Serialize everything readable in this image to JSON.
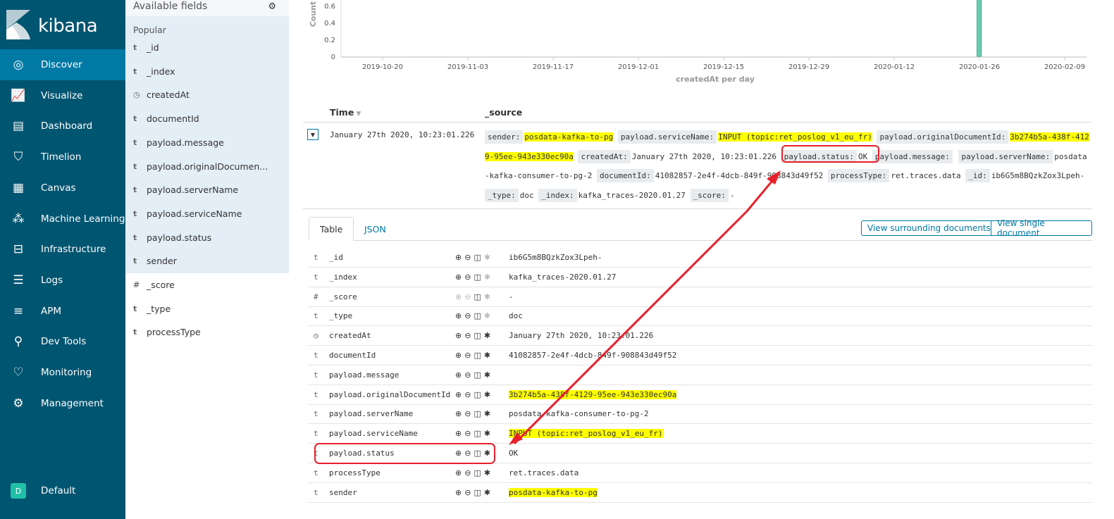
{
  "app": {
    "logo_text": "kibana"
  },
  "nav": {
    "items": [
      {
        "label": "Discover",
        "icon": "compass-icon",
        "active": true
      },
      {
        "label": "Visualize",
        "icon": "visualize-icon"
      },
      {
        "label": "Dashboard",
        "icon": "dashboard-icon"
      },
      {
        "label": "Timelion",
        "icon": "timelion-icon"
      },
      {
        "label": "Canvas",
        "icon": "canvas-icon"
      },
      {
        "label": "Machine Learning",
        "icon": "ml-icon"
      },
      {
        "label": "Infrastructure",
        "icon": "infrastructure-icon"
      },
      {
        "label": "Logs",
        "icon": "logs-icon"
      },
      {
        "label": "APM",
        "icon": "apm-icon"
      },
      {
        "label": "Dev Tools",
        "icon": "wrench-icon"
      },
      {
        "label": "Monitoring",
        "icon": "heartbeat-icon"
      },
      {
        "label": "Management",
        "icon": "gear-icon"
      }
    ],
    "space": {
      "badge": "D",
      "label": "Default"
    }
  },
  "fields": {
    "title": "Available fields",
    "popular_label": "Popular",
    "items": [
      {
        "type": "t",
        "name": "_id"
      },
      {
        "type": "t",
        "name": "_index"
      },
      {
        "type": "clock",
        "name": "createdAt"
      },
      {
        "type": "t",
        "name": "documentId"
      },
      {
        "type": "t",
        "name": "payload.message"
      },
      {
        "type": "t",
        "name": "payload.originalDocumen..."
      },
      {
        "type": "t",
        "name": "payload.serverName"
      },
      {
        "type": "t",
        "name": "payload.serviceName"
      },
      {
        "type": "t",
        "name": "payload.status"
      },
      {
        "type": "t",
        "name": "sender"
      },
      {
        "type": "#",
        "name": "_score"
      },
      {
        "type": "t",
        "name": "_type"
      },
      {
        "type": "t",
        "name": "processType"
      }
    ]
  },
  "chart_data": {
    "type": "bar",
    "ylabel": "Count",
    "xlabel": "createdAt per day",
    "yticks": [
      0,
      0.2,
      0.4,
      0.6
    ],
    "ylim_visible": [
      0,
      0.6
    ],
    "xticks": [
      "2019-10-20",
      "2019-11-03",
      "2019-11-17",
      "2019-12-01",
      "2019-12-15",
      "2019-12-29",
      "2020-01-12",
      "2020-01-26",
      "2020-02-09"
    ],
    "x": [
      "2020-01-27"
    ],
    "values": [
      1
    ],
    "color": "#6dccb1",
    "grid": false
  },
  "docs": {
    "time_header": "Time",
    "source_header": "_source",
    "time": "January 27th 2020, 10:23:01.226",
    "source": [
      {
        "k": "sender:",
        "v": "posdata-kafka-to-pg",
        "hl": true
      },
      {
        "k": "payload.serviceName:",
        "v": "INPUT (topic:ret_poslog_v1_eu_fr)",
        "hl": true
      },
      {
        "k": "payload.originalDocumentId:",
        "v": "3b274b5a-438f-4129-95ee-943e330ec90a",
        "hl": true
      },
      {
        "k": "createdAt:",
        "v": "January 27th 2020, 10:23:01.226"
      },
      {
        "k": "payload.status:",
        "v": "OK"
      },
      {
        "k": "payload.message:",
        "v": ""
      },
      {
        "k": "payload.serverName:",
        "v": "posdata-kafka-consumer-to-pg-2"
      },
      {
        "k": "documentId:",
        "v": "41082857-2e4f-4dcb-849f-908843d49f52"
      },
      {
        "k": "processType:",
        "v": "ret.traces.data"
      },
      {
        "k": "_id:",
        "v": "ib6G5m8BQzkZox3Lpeh-"
      },
      {
        "k": "_type:",
        "v": "doc"
      },
      {
        "k": "_index:",
        "v": "kafka_traces-2020.01.27"
      },
      {
        "k": "_score:",
        "v": "-"
      }
    ]
  },
  "detail": {
    "tabs": [
      "Table",
      "JSON"
    ],
    "btn_surrounding": "View surrounding documents",
    "btn_single": "View single document",
    "rows": [
      {
        "type": "t",
        "field": "_id",
        "value": "ib6G5m8BQzkZox3Lpeh-"
      },
      {
        "type": "t",
        "field": "_index",
        "value": "kafka_traces-2020.01.27"
      },
      {
        "type": "#",
        "field": "_score",
        "value": " -"
      },
      {
        "type": "t",
        "field": "_type",
        "value": "doc"
      },
      {
        "type": "clock",
        "field": "createdAt",
        "value": "January 27th 2020, 10:23:01.226"
      },
      {
        "type": "t",
        "field": "documentId",
        "value": "41082857-2e4f-4dcb-849f-908843d49f52"
      },
      {
        "type": "t",
        "field": "payload.message",
        "value": ""
      },
      {
        "type": "t",
        "field": "payload.originalDocumentId",
        "value": "3b274b5a-438f-4129-95ee-943e330ec90a",
        "hl": true
      },
      {
        "type": "t",
        "field": "payload.serverName",
        "value": "posdata-kafka-consumer-to-pg-2"
      },
      {
        "type": "t",
        "field": "payload.serviceName",
        "value": "INPUT (topic:ret_poslog_v1_eu_fr)",
        "hl": true
      },
      {
        "type": "t",
        "field": "payload.status",
        "value": "OK"
      },
      {
        "type": "t",
        "field": "processType",
        "value": "ret.traces.data"
      },
      {
        "type": "t",
        "field": "sender",
        "value": "posdata-kafka-to-pg",
        "hl": true
      }
    ]
  },
  "annotation_color": "#e8202a"
}
